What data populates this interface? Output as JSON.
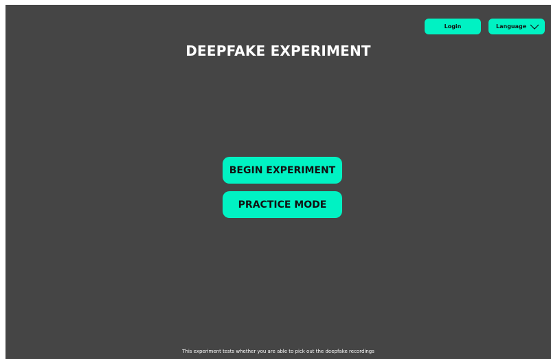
{
  "header": {
    "login_label": "Login",
    "language_label": "Language",
    "language_icon": "chevron-down-icon"
  },
  "main": {
    "title": "DEEPFAKE EXPERIMENT",
    "begin_label": "BEGIN EXPERIMENT",
    "practice_label": "PRACTICE MODE"
  },
  "footer": {
    "description": "This experiment tests whether you are able to pick out the deepfake recordings"
  },
  "colors": {
    "background": "#454545",
    "accent": "#00f2c3",
    "text_light": "#ffffff",
    "text_dark": "#111111"
  }
}
